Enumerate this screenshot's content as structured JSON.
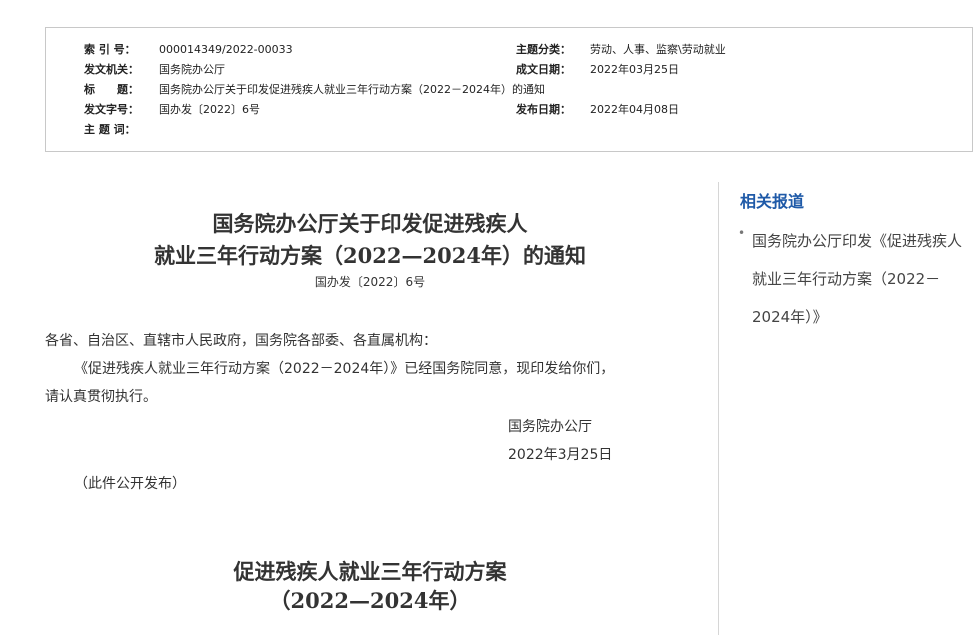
{
  "metadata": {
    "index_label": "索 引 号：",
    "index_value": "000014349/2022-00033",
    "category_label": "主题分类：",
    "category_value": "劳动、人事、监察\\劳动就业",
    "issuer_label": "发文机关：",
    "issuer_value": "国务院办公厅",
    "written_date_label": "成文日期：",
    "written_date_value": "2022年03月25日",
    "title_label": "标　　题：",
    "title_value": "国务院办公厅关于印发促进残疾人就业三年行动方案（2022－2024年）的通知",
    "doc_number_label": "发文字号：",
    "doc_number_value": "国办发〔2022〕6号",
    "publish_date_label": "发布日期：",
    "publish_date_value": "2022年04月08日",
    "keywords_label": "主 题 词："
  },
  "sidebar": {
    "title": "相关报道",
    "bullet": "•",
    "link_text": "国务院办公厅印发《促进残疾人就业三年行动方案（2022－2024年）》"
  },
  "document": {
    "title_line1": "国务院办公厅关于印发促进残疾人",
    "title_line2": "就业三年行动方案（2022—2024年）的通知",
    "doc_number": "国办发〔2022〕6号",
    "salutation": "各省、自治区、直辖市人民政府，国务院各部委、各直属机构：",
    "paragraph_line1": "《促进残疾人就业三年行动方案（2022－2024年）》已经国务院同意，现印发给你们，",
    "paragraph_line2": "请认真贯彻执行。",
    "signer": "国务院办公厅",
    "sign_date": "2022年3月25日",
    "public_note": "（此件公开发布）",
    "plan_title_line1": "促进残疾人就业三年行动方案",
    "plan_title_line2": "（2022—2024年）"
  }
}
